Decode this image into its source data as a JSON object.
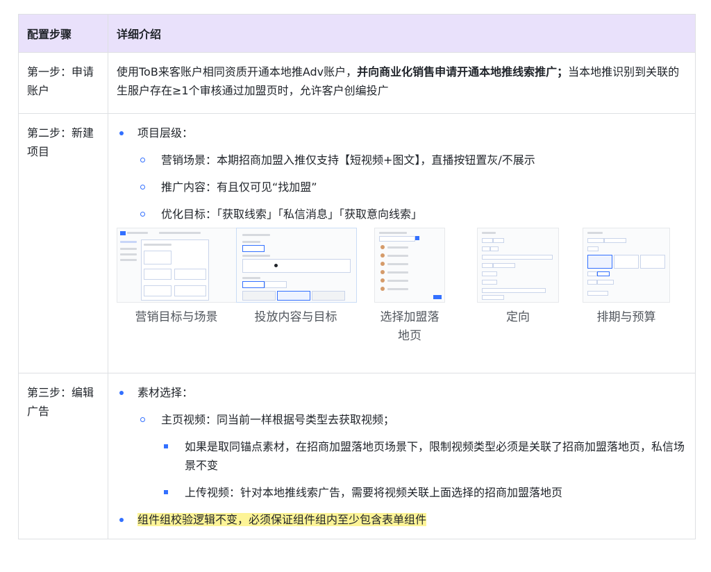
{
  "header": {
    "col1": "配置步骤",
    "col2": "详细介绍"
  },
  "rows": [
    {
      "step": "第一步：申请账户",
      "text_a": "使用ToB来客账户相同资质开通本地推Adv账户，",
      "text_bold": "并向商业化销售申请开通本地推线索推广；",
      "text_b": "当本地推识别到关联的生服户存在≥1个审核通过加盟页时，允许客户创编投广"
    },
    {
      "step": "第二步：新建项目",
      "bullet": "项目层级：",
      "sub": [
        "营销场景：本期招商加盟入推仅支持【短视频+图文】，直播按钮置灰/不展示",
        "推广内容：有且仅可见“找加盟”",
        "优化目标：「获取线索」「私信消息」「获取意向线索」"
      ],
      "thumbnails": [
        "营销目标与场景",
        "投放内容与目标",
        "选择加盟落地页",
        "定向",
        "排期与预算"
      ]
    },
    {
      "step": "第三步：编辑广告",
      "bullet": "素材选择：",
      "sub": "主页视频：同当前一样根据号类型去获取视频；",
      "subsub": [
        "如果是取同锚点素材，在招商加盟落地页场景下，限制视频类型必须是关联了招商加盟落地页，私信场景不变",
        "上传视频：针对本地推线索广告，需要将视频关联上面选择的招商加盟落地页"
      ],
      "highlight": "组件组校验逻辑不变，必须保证组件组内至少包含表单组件"
    }
  ],
  "colors": {
    "header_bg": "#e9e1fb",
    "bullet": "#3370ff",
    "highlight": "#fdf497"
  }
}
